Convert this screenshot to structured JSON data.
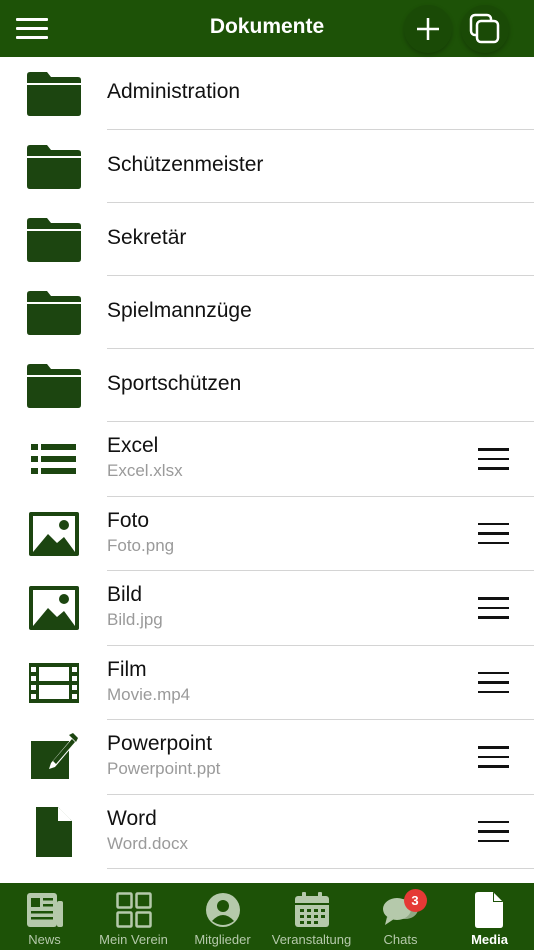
{
  "header": {
    "title": "Dokumente",
    "menu_icon": "hamburger-icon",
    "add_icon": "plus-icon",
    "copy_icon": "copy-icon"
  },
  "folders": [
    {
      "label": "Administration",
      "icon": "folder-icon"
    },
    {
      "label": "Schützenmeister",
      "icon": "folder-icon"
    },
    {
      "label": "Sekretär",
      "icon": "folder-icon"
    },
    {
      "label": "Spielmannzüge",
      "icon": "folder-icon"
    },
    {
      "label": "Sportschützen",
      "icon": "folder-icon"
    }
  ],
  "files": [
    {
      "label": "Excel",
      "filename": "Excel.xlsx",
      "icon": "list-icon"
    },
    {
      "label": "Foto",
      "filename": "Foto.png",
      "icon": "image-icon"
    },
    {
      "label": "Bild",
      "filename": "Bild.jpg",
      "icon": "image-icon"
    },
    {
      "label": "Film",
      "filename": "Movie.mp4",
      "icon": "film-icon"
    },
    {
      "label": "Powerpoint",
      "filename": "Powerpoint.ppt",
      "icon": "edit-icon"
    },
    {
      "label": "Word",
      "filename": "Word.docx",
      "icon": "document-icon"
    }
  ],
  "nav": [
    {
      "label": "News",
      "icon": "newspaper-icon"
    },
    {
      "label": "Mein Verein",
      "icon": "grid-icon"
    },
    {
      "label": "Mitglieder",
      "icon": "person-icon"
    },
    {
      "label": "Veranstaltung",
      "icon": "calendar-icon"
    },
    {
      "label": "Chats",
      "icon": "chat-icon",
      "badge": "3"
    },
    {
      "label": "Media",
      "icon": "file-icon",
      "active": true
    }
  ],
  "colors": {
    "primary": "#1d5207",
    "icon": "#1c4510",
    "badge": "#e53935",
    "subtext": "#9a9a9a"
  }
}
